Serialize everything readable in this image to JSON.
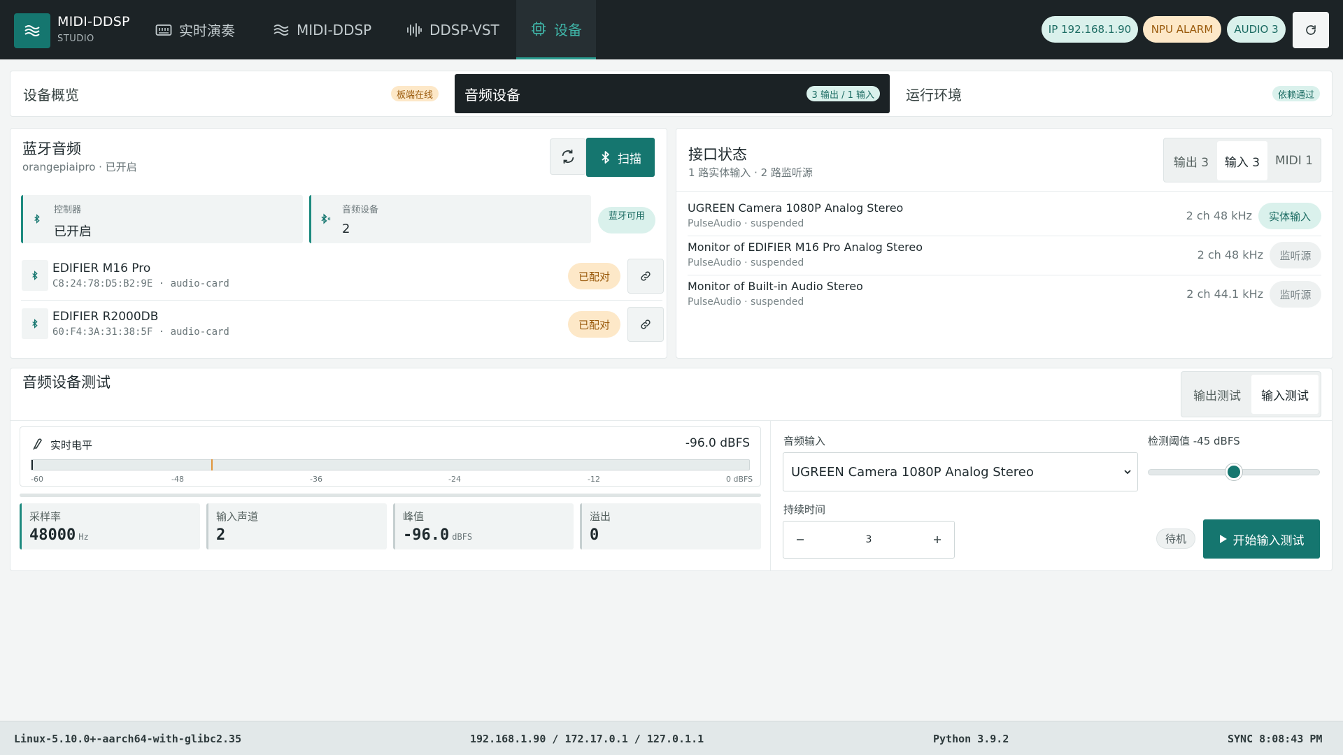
{
  "header": {
    "brand_name": "MIDI-DDSP",
    "brand_sub": "STUDIO",
    "nav": [
      {
        "label": "实时演奏",
        "icon": "keyboard-icon"
      },
      {
        "label": "MIDI-DDSP",
        "icon": "waves-icon"
      },
      {
        "label": "DDSP-VST",
        "icon": "waveform-icon"
      },
      {
        "label": "设备",
        "icon": "chip-icon",
        "active": true
      }
    ],
    "status_ip": "IP 192.168.1.90",
    "status_npu": "NPU ALARM",
    "status_audio": "AUDIO 3",
    "refresh_icon": "refresh-icon"
  },
  "section_tabs": [
    {
      "label": "设备概览",
      "badge": "板端在线"
    },
    {
      "label": "音频设备",
      "badge": "3 输出 / 1 输入",
      "active": true
    },
    {
      "label": "运行环境",
      "badge": "依赖通过"
    }
  ],
  "bluetooth": {
    "title": "蓝牙音频",
    "subtitle": "orangepiaipro · 已开启",
    "scan_label": "扫描",
    "controller_label": "控制器",
    "controller_value": "已开启",
    "devices_label": "音频设备",
    "devices_value": "2",
    "available_badge": "蓝牙可用",
    "devices": [
      {
        "name": "EDIFIER M16 Pro",
        "meta": "C8:24:78:D5:B2:9E · audio-card",
        "status": "已配对"
      },
      {
        "name": "EDIFIER R2000DB",
        "meta": "60:F4:3A:31:38:5F · audio-card",
        "status": "已配对"
      }
    ]
  },
  "interfaces": {
    "title": "接口状态",
    "subtitle": "1 路实体输入 · 2 路监听源",
    "tabs": [
      "输出 3",
      "输入 3",
      "MIDI 1"
    ],
    "active_tab": "输入 3",
    "rows": [
      {
        "name": "UGREEN Camera 1080P Analog Stereo",
        "meta": "PulseAudio · suspended",
        "spec": "2 ch  48 kHz",
        "tag": "实体输入"
      },
      {
        "name": "Monitor of EDIFIER M16 Pro Analog Stereo",
        "meta": "PulseAudio · suspended",
        "spec": "2 ch  48 kHz",
        "tag": "监听源"
      },
      {
        "name": "Monitor of Built-in Audio Stereo",
        "meta": "PulseAudio · suspended",
        "spec": "2 ch  44.1 kHz",
        "tag": "监听源"
      }
    ]
  },
  "audio_test": {
    "title": "音频设备测试",
    "tabs": [
      "输出测试",
      "输入测试"
    ],
    "active_tab": "输入测试",
    "meter_label": "实时电平",
    "meter_value": "-96.0 dBFS",
    "meter_ticks": [
      "-60",
      "-48",
      "-36",
      "-24",
      "-12",
      "0 dBFS"
    ],
    "meter_level_dbfs": -96.0,
    "meter_threshold_dbfs": -45,
    "metrics": [
      {
        "label": "采样率",
        "value": "48000",
        "unit": "Hz"
      },
      {
        "label": "输入声道",
        "value": "2",
        "unit": ""
      },
      {
        "label": "峰值",
        "value": "-96.0",
        "unit": "dBFS"
      },
      {
        "label": "溢出",
        "value": "0",
        "unit": ""
      }
    ],
    "input_label": "音频输入",
    "input_value": "UGREEN Camera 1080P Analog Stereo",
    "threshold_label": "检测阈值 -45 dBFS",
    "threshold_value_dbfs": -45,
    "threshold_range_dbfs": [
      -90,
      0
    ],
    "duration_label": "持续时间",
    "duration_value": "3",
    "state_badge": "待机",
    "start_label": "开始输入测试"
  },
  "footer": {
    "platform": "Linux-5.10.0+-aarch64-with-glibc2.35",
    "ips": "192.168.1.90 / 172.17.0.1 / 127.0.1.1",
    "python": "Python 3.9.2",
    "sync": "SYNC 8:08:43 PM"
  },
  "colors": {
    "accent": "#15766f",
    "header_bg": "#1c2326",
    "warn": "#e0953a"
  }
}
